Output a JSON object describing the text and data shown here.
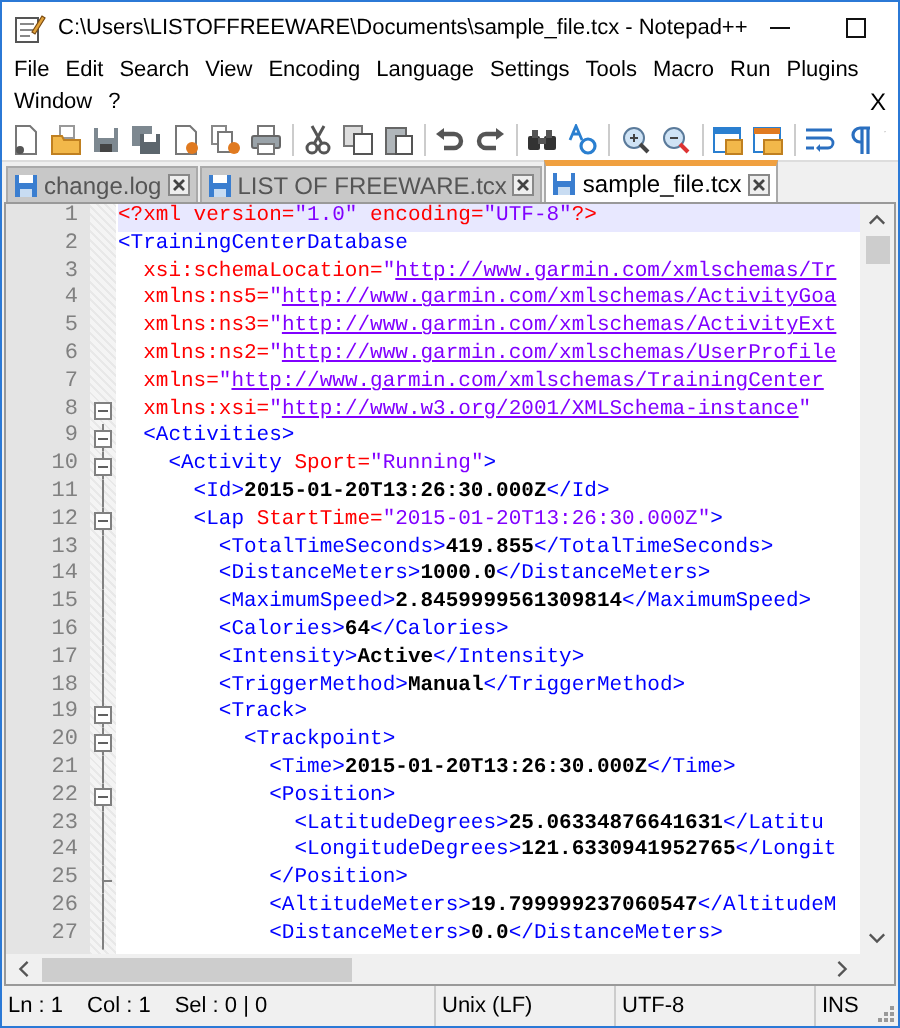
{
  "window": {
    "title": "C:\\Users\\LISTOFFREEWARE\\Documents\\sample_file.tcx - Notepad++"
  },
  "menu_rows": [
    [
      "File",
      "Edit",
      "Search",
      "View",
      "Encoding",
      "Language",
      "Settings",
      "Tools",
      "Macro",
      "Run",
      "Plugins"
    ],
    [
      "Window",
      "?"
    ]
  ],
  "close_document": "X",
  "tabs": [
    {
      "label": "change.log",
      "selected": false
    },
    {
      "label": "LIST OF FREEWARE.tcx",
      "selected": false
    },
    {
      "label": "sample_file.tcx",
      "selected": true
    }
  ],
  "editor": {
    "lines": [
      {
        "number": "1",
        "collapsible": false,
        "block_end": false,
        "current": true,
        "tokens": [
          {
            "kind": "decl",
            "text": "<?xml version="
          },
          {
            "kind": "value",
            "text": "\"1.0\""
          },
          {
            "kind": "decl",
            "text": " encoding="
          },
          {
            "kind": "value",
            "text": "\"UTF-8\""
          },
          {
            "kind": "decl",
            "text": "?>"
          }
        ]
      },
      {
        "number": "2",
        "collapsible": false,
        "block_end": false,
        "current": false,
        "tokens": [
          {
            "kind": "tag",
            "text": "<TrainingCenterDatabase"
          }
        ]
      },
      {
        "number": "3",
        "collapsible": false,
        "block_end": false,
        "current": false,
        "tokens": [
          {
            "kind": "attr",
            "text": "  xsi:schemaLocation="
          },
          {
            "kind": "value",
            "text": "\""
          },
          {
            "kind": "link",
            "text": "http://www.garmin.com/xmlschemas/Tr"
          }
        ]
      },
      {
        "number": "4",
        "collapsible": false,
        "block_end": false,
        "current": false,
        "tokens": [
          {
            "kind": "attr",
            "text": "  xmlns:ns5="
          },
          {
            "kind": "value",
            "text": "\""
          },
          {
            "kind": "link",
            "text": "http://www.garmin.com/xmlschemas/ActivityGoa"
          }
        ]
      },
      {
        "number": "5",
        "collapsible": false,
        "block_end": false,
        "current": false,
        "tokens": [
          {
            "kind": "attr",
            "text": "  xmlns:ns3="
          },
          {
            "kind": "value",
            "text": "\""
          },
          {
            "kind": "link",
            "text": "http://www.garmin.com/xmlschemas/ActivityExt"
          }
        ]
      },
      {
        "number": "6",
        "collapsible": false,
        "block_end": false,
        "current": false,
        "tokens": [
          {
            "kind": "attr",
            "text": "  xmlns:ns2="
          },
          {
            "kind": "value",
            "text": "\""
          },
          {
            "kind": "link",
            "text": "http://www.garmin.com/xmlschemas/UserProfile"
          }
        ]
      },
      {
        "number": "7",
        "collapsible": false,
        "block_end": false,
        "current": false,
        "tokens": [
          {
            "kind": "attr",
            "text": "  xmlns="
          },
          {
            "kind": "value",
            "text": "\""
          },
          {
            "kind": "link",
            "text": "http://www.garmin.com/xmlschemas/TrainingCenter"
          }
        ]
      },
      {
        "number": "8",
        "collapsible": true,
        "block_end": false,
        "current": false,
        "tokens": [
          {
            "kind": "attr",
            "text": "  xmlns:xsi="
          },
          {
            "kind": "value",
            "text": "\""
          },
          {
            "kind": "link",
            "text": "http://www.w3.org/2001/XMLSchema-instance"
          },
          {
            "kind": "value",
            "text": "\""
          }
        ]
      },
      {
        "number": "9",
        "collapsible": true,
        "block_end": false,
        "current": false,
        "tokens": [
          {
            "kind": "tag",
            "text": "  <Activities>"
          }
        ]
      },
      {
        "number": "10",
        "collapsible": true,
        "block_end": false,
        "current": false,
        "tokens": [
          {
            "kind": "tag",
            "text": "    <Activity "
          },
          {
            "kind": "attr",
            "text": "Sport="
          },
          {
            "kind": "value",
            "text": "\"Running\""
          },
          {
            "kind": "tag",
            "text": ">"
          }
        ]
      },
      {
        "number": "11",
        "collapsible": false,
        "block_end": false,
        "current": false,
        "tokens": [
          {
            "kind": "tag",
            "text": "      <Id>"
          },
          {
            "kind": "text",
            "text": "2015-01-20T13:26:30.000Z"
          },
          {
            "kind": "tag",
            "text": "</Id>"
          }
        ]
      },
      {
        "number": "12",
        "collapsible": true,
        "block_end": false,
        "current": false,
        "tokens": [
          {
            "kind": "tag",
            "text": "      <Lap "
          },
          {
            "kind": "attr",
            "text": "StartTime="
          },
          {
            "kind": "value",
            "text": "\"2015-01-20T13:26:30.000Z\""
          },
          {
            "kind": "tag",
            "text": ">"
          }
        ]
      },
      {
        "number": "13",
        "collapsible": false,
        "block_end": false,
        "current": false,
        "tokens": [
          {
            "kind": "tag",
            "text": "        <TotalTimeSeconds>"
          },
          {
            "kind": "text",
            "text": "419.855"
          },
          {
            "kind": "tag",
            "text": "</TotalTimeSeconds>"
          }
        ]
      },
      {
        "number": "14",
        "collapsible": false,
        "block_end": false,
        "current": false,
        "tokens": [
          {
            "kind": "tag",
            "text": "        <DistanceMeters>"
          },
          {
            "kind": "text",
            "text": "1000.0"
          },
          {
            "kind": "tag",
            "text": "</DistanceMeters>"
          }
        ]
      },
      {
        "number": "15",
        "collapsible": false,
        "block_end": false,
        "current": false,
        "tokens": [
          {
            "kind": "tag",
            "text": "        <MaximumSpeed>"
          },
          {
            "kind": "text",
            "text": "2.8459999561309814"
          },
          {
            "kind": "tag",
            "text": "</MaximumSpeed>"
          }
        ]
      },
      {
        "number": "16",
        "collapsible": false,
        "block_end": false,
        "current": false,
        "tokens": [
          {
            "kind": "tag",
            "text": "        <Calories>"
          },
          {
            "kind": "text",
            "text": "64"
          },
          {
            "kind": "tag",
            "text": "</Calories>"
          }
        ]
      },
      {
        "number": "17",
        "collapsible": false,
        "block_end": false,
        "current": false,
        "tokens": [
          {
            "kind": "tag",
            "text": "        <Intensity>"
          },
          {
            "kind": "text",
            "text": "Active"
          },
          {
            "kind": "tag",
            "text": "</Intensity>"
          }
        ]
      },
      {
        "number": "18",
        "collapsible": false,
        "block_end": false,
        "current": false,
        "tokens": [
          {
            "kind": "tag",
            "text": "        <TriggerMethod>"
          },
          {
            "kind": "text",
            "text": "Manual"
          },
          {
            "kind": "tag",
            "text": "</TriggerMethod>"
          }
        ]
      },
      {
        "number": "19",
        "collapsible": true,
        "block_end": false,
        "current": false,
        "tokens": [
          {
            "kind": "tag",
            "text": "        <Track>"
          }
        ]
      },
      {
        "number": "20",
        "collapsible": true,
        "block_end": false,
        "current": false,
        "tokens": [
          {
            "kind": "tag",
            "text": "          <Trackpoint>"
          }
        ]
      },
      {
        "number": "21",
        "collapsible": false,
        "block_end": false,
        "current": false,
        "tokens": [
          {
            "kind": "tag",
            "text": "            <Time>"
          },
          {
            "kind": "text",
            "text": "2015-01-20T13:26:30.000Z"
          },
          {
            "kind": "tag",
            "text": "</Time>"
          }
        ]
      },
      {
        "number": "22",
        "collapsible": true,
        "block_end": false,
        "current": false,
        "tokens": [
          {
            "kind": "tag",
            "text": "            <Position>"
          }
        ]
      },
      {
        "number": "23",
        "collapsible": false,
        "block_end": false,
        "current": false,
        "tokens": [
          {
            "kind": "tag",
            "text": "              <LatitudeDegrees>"
          },
          {
            "kind": "text",
            "text": "25.06334876641631"
          },
          {
            "kind": "tag",
            "text": "</Latitu"
          }
        ]
      },
      {
        "number": "24",
        "collapsible": false,
        "block_end": false,
        "current": false,
        "tokens": [
          {
            "kind": "tag",
            "text": "              <LongitudeDegrees>"
          },
          {
            "kind": "text",
            "text": "121.6330941952765"
          },
          {
            "kind": "tag",
            "text": "</Longit"
          }
        ]
      },
      {
        "number": "25",
        "collapsible": false,
        "block_end": true,
        "current": false,
        "tokens": [
          {
            "kind": "tag",
            "text": "            </Position>"
          }
        ]
      },
      {
        "number": "26",
        "collapsible": false,
        "block_end": false,
        "current": false,
        "tokens": [
          {
            "kind": "tag",
            "text": "            <AltitudeMeters>"
          },
          {
            "kind": "text",
            "text": "19.799999237060547"
          },
          {
            "kind": "tag",
            "text": "</AltitudeM"
          }
        ]
      },
      {
        "number": "27",
        "collapsible": false,
        "block_end": false,
        "current": false,
        "tokens": [
          {
            "kind": "tag",
            "text": "            <DistanceMeters>"
          },
          {
            "kind": "text",
            "text": "0.0"
          },
          {
            "kind": "tag",
            "text": "</DistanceMeters>"
          }
        ]
      }
    ]
  },
  "status_bar": {
    "segments": [
      {
        "items": [
          "Ln : 1",
          "Col : 1",
          "Sel : 0 | 0"
        ]
      },
      {
        "items": [
          "Unix (LF)"
        ]
      },
      {
        "items": [
          "UTF-8"
        ]
      },
      {
        "items": [
          "INS"
        ]
      }
    ]
  }
}
